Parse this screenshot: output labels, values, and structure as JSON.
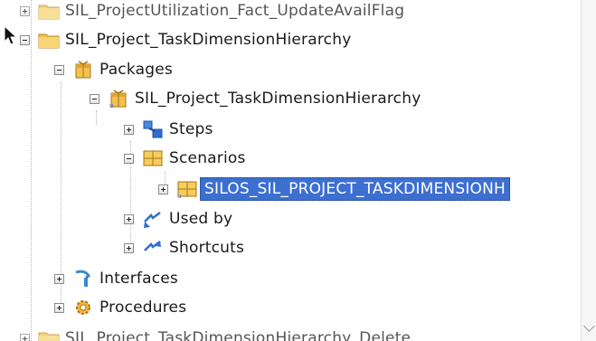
{
  "tree": {
    "items": [
      {
        "label": "SIL_ProjectUtilization_Fact_UpdateAvailFlag",
        "icon": "folder-icon"
      },
      {
        "label": "SIL_Project_TaskDimensionHierarchy",
        "icon": "folder-icon"
      },
      {
        "label": "Packages",
        "icon": "package-icon"
      },
      {
        "label": "SIL_Project_TaskDimensionHierarchy",
        "icon": "package-icon"
      },
      {
        "label": "Steps",
        "icon": "steps-icon"
      },
      {
        "label": "Scenarios",
        "icon": "scenario-icon"
      },
      {
        "label": "SILOS_SIL_PROJECT_TASKDIMENSIONH",
        "icon": "scenario-icon"
      },
      {
        "label": "Used by",
        "icon": "used-by-icon"
      },
      {
        "label": "Shortcuts",
        "icon": "shortcut-icon"
      },
      {
        "label": "Interfaces",
        "icon": "interface-icon"
      },
      {
        "label": "Procedures",
        "icon": "procedure-icon"
      },
      {
        "label": "SIL_Project_TaskDimensionHierarchy_Delete",
        "icon": "folder-icon"
      }
    ]
  },
  "colors": {
    "selection": "#3d6fd0",
    "folder": "#f2c14e",
    "guide": "#b8b8b8"
  }
}
